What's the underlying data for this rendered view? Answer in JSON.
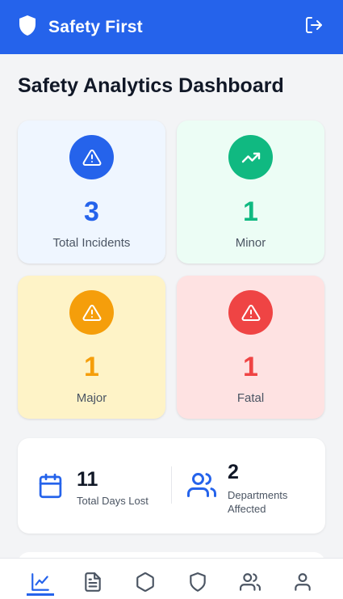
{
  "app": {
    "title": "Safety First"
  },
  "page": {
    "title": "Safety Analytics Dashboard"
  },
  "stats": [
    {
      "value": "3",
      "label": "Total Incidents",
      "color": "#2563eb"
    },
    {
      "value": "1",
      "label": "Minor",
      "color": "#10b981"
    },
    {
      "value": "1",
      "label": "Major",
      "color": "#f59e0b"
    },
    {
      "value": "1",
      "label": "Fatal",
      "color": "#ef4444"
    }
  ],
  "summary": {
    "days_lost": {
      "value": "11",
      "label": "Total Days Lost"
    },
    "departments": {
      "value": "2",
      "label_line1": "Departments",
      "label_line2": "Affected"
    }
  },
  "nav": {
    "items": [
      "analytics-icon",
      "report-icon",
      "hexagon-icon",
      "shield-icon",
      "users-icon",
      "profile-icon"
    ],
    "active": "analytics-icon"
  },
  "colors": {
    "primary": "#2563eb",
    "text": "#111827",
    "muted": "#4b5563"
  }
}
